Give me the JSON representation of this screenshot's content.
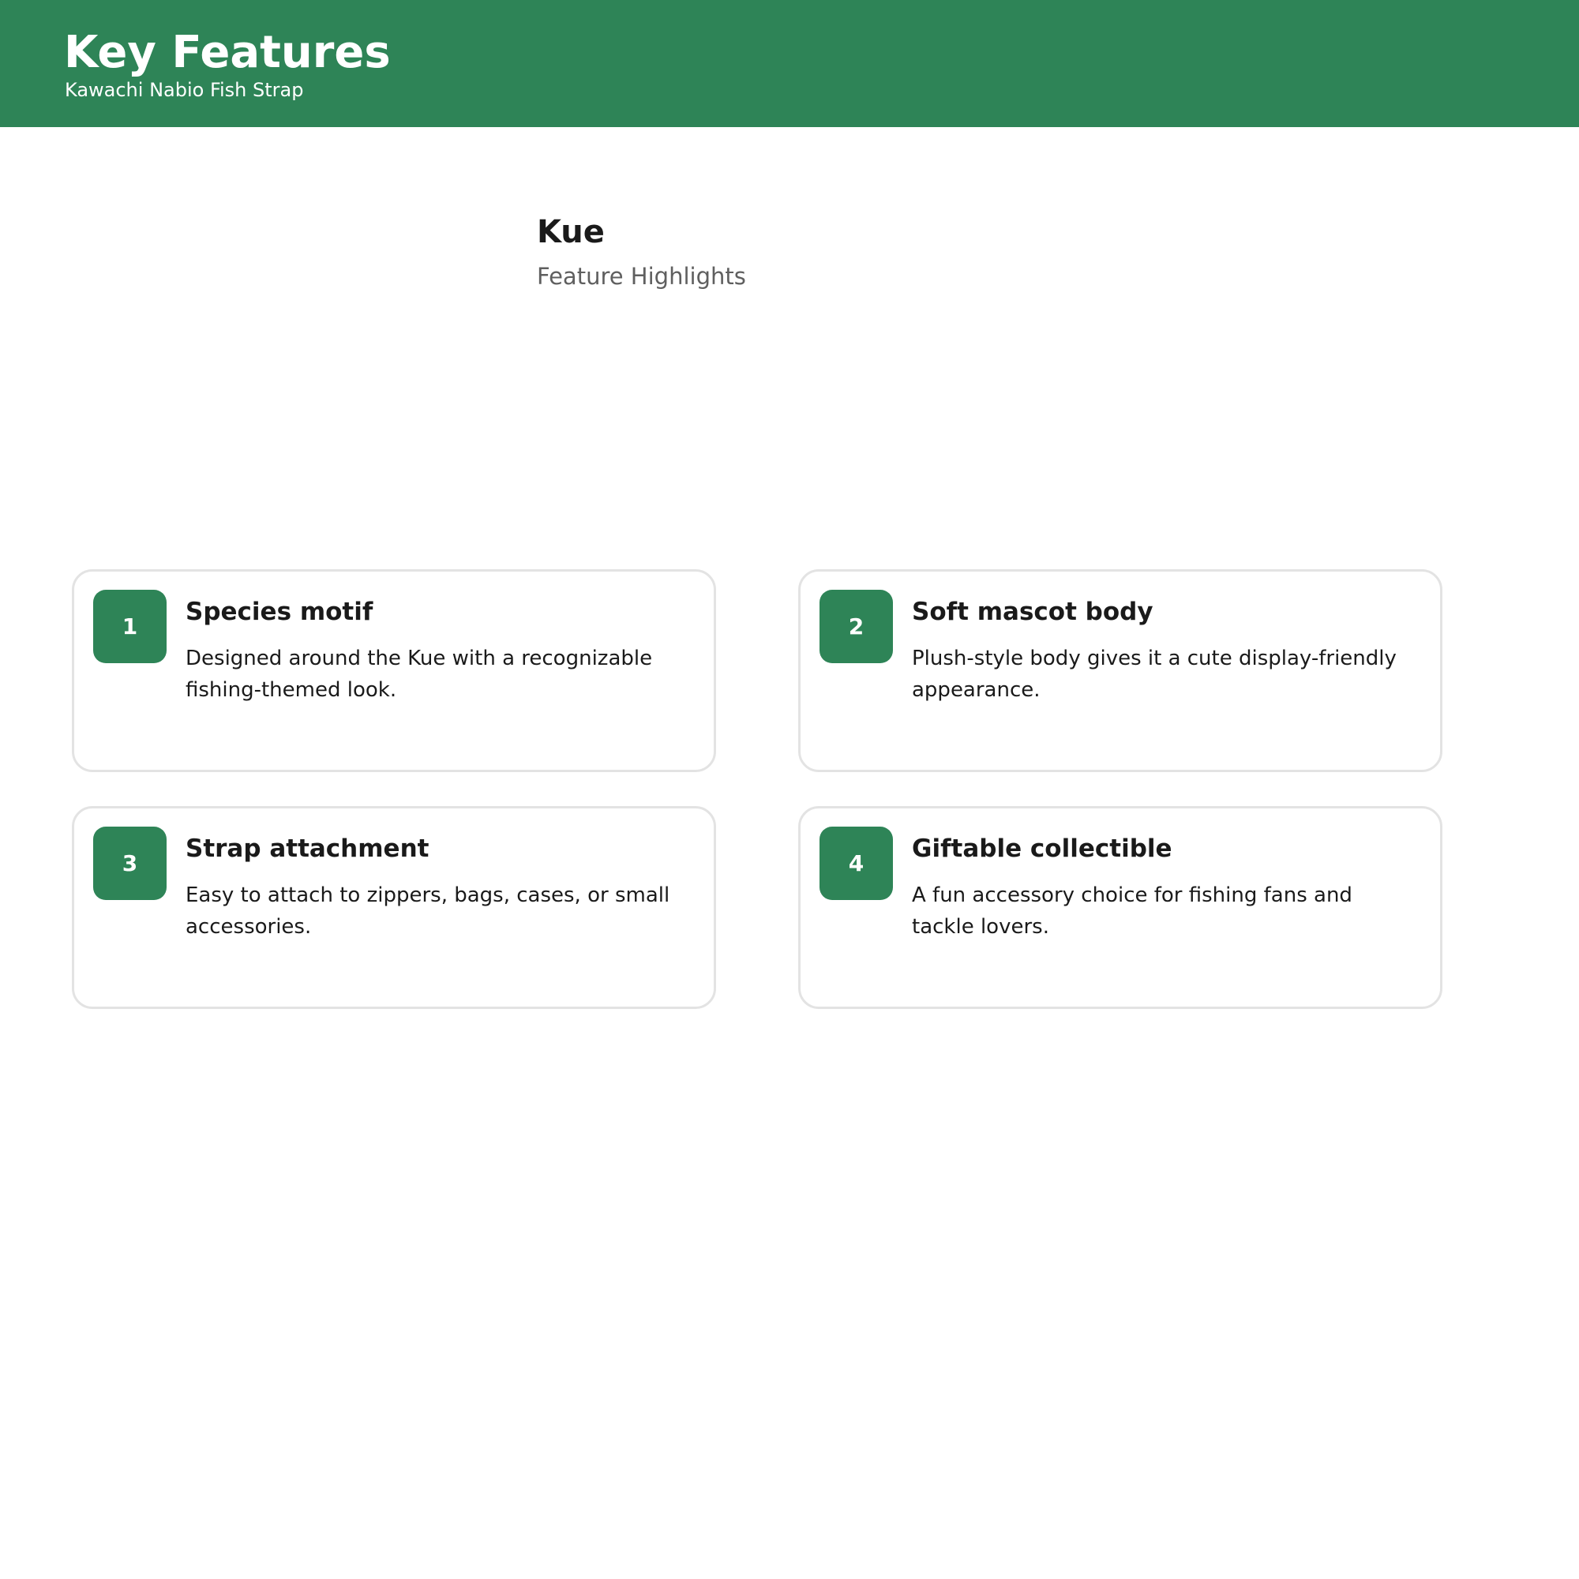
{
  "header": {
    "title": "Key Features",
    "subtitle": "Kawachi Nabio Fish Strap"
  },
  "product": {
    "name": "Kue",
    "section_label": "Feature Highlights"
  },
  "colors": {
    "accent": "#2e8457",
    "card_border": "#e3e3e3",
    "muted_text": "#5f5f5f"
  },
  "features": [
    {
      "number": "1",
      "title": "Species motif",
      "description": "Designed around the Kue with a recognizable fishing-themed look."
    },
    {
      "number": "2",
      "title": "Soft mascot body",
      "description": "Plush-style body gives it a cute display-friendly appearance."
    },
    {
      "number": "3",
      "title": "Strap attachment",
      "description": "Easy to attach to zippers, bags, cases, or small accessories."
    },
    {
      "number": "4",
      "title": "Giftable collectible",
      "description": "A fun accessory choice for fishing fans and tackle lovers."
    }
  ]
}
